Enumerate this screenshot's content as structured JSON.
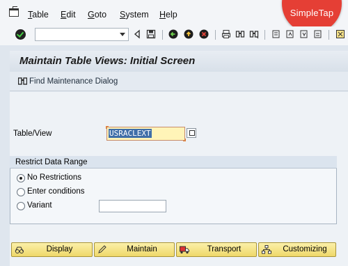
{
  "menu": {
    "items": [
      {
        "first": "T",
        "rest": "able"
      },
      {
        "first": "E",
        "rest": "dit"
      },
      {
        "first": "G",
        "rest": "oto"
      },
      {
        "first": "S",
        "rest": "ystem"
      },
      {
        "first": "H",
        "rest": "elp"
      }
    ]
  },
  "logo": {
    "text": "SimpleTap",
    "color": "#e53f35"
  },
  "toolbar": {
    "command_value": ""
  },
  "page": {
    "title": "Maintain Table Views: Initial Screen"
  },
  "app_toolbar": {
    "find_label": "Find Maintenance Dialog"
  },
  "form": {
    "table_label": "Table/View",
    "table_value": "USRACLEXT"
  },
  "restrict": {
    "title": "Restrict Data Range",
    "options": [
      {
        "label": "No Restrictions",
        "selected": true
      },
      {
        "label": "Enter conditions",
        "selected": false
      },
      {
        "label": "Variant",
        "selected": false
      }
    ],
    "variant_value": ""
  },
  "buttons": {
    "display": "Display",
    "maintain": "Maintain",
    "transport": "Transport",
    "customizing": "Customizing"
  },
  "colors": {
    "accent_button": "#f5e27f",
    "input_highlight": "#fff4b8"
  }
}
